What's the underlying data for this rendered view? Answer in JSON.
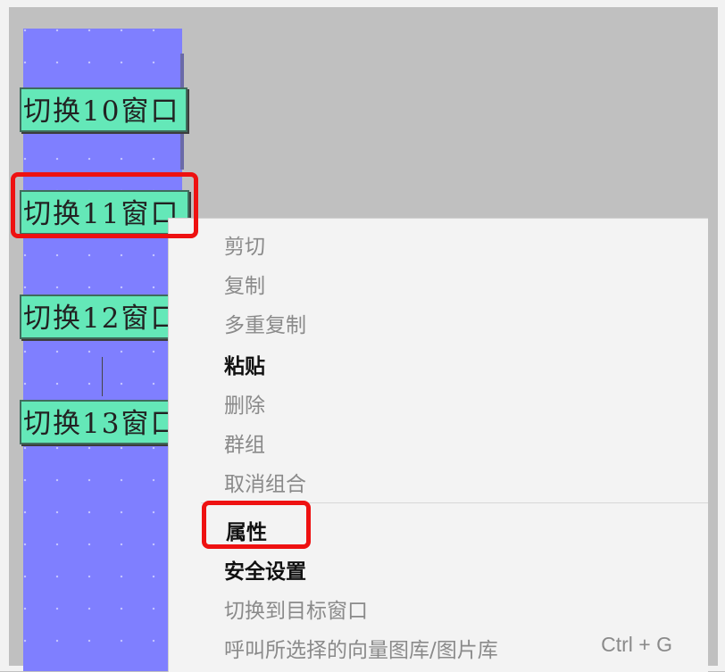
{
  "panel": {
    "buttons": [
      {
        "label": "切换10窗口"
      },
      {
        "label": "切换11窗口"
      },
      {
        "label": "切换12窗口"
      },
      {
        "label": "切换13窗口"
      }
    ]
  },
  "context_menu": {
    "items": [
      {
        "label": "剪切",
        "enabled": false
      },
      {
        "label": "复制",
        "enabled": false
      },
      {
        "label": "多重复制",
        "enabled": false
      },
      {
        "label": "粘贴",
        "enabled": true
      },
      {
        "label": "删除",
        "enabled": false
      },
      {
        "label": "群组",
        "enabled": false
      },
      {
        "label": "取消组合",
        "enabled": false
      },
      {
        "label": "属性",
        "enabled": true
      },
      {
        "label": "安全设置",
        "enabled": true
      },
      {
        "label": "切换到目标窗口",
        "enabled": false
      },
      {
        "label": "呼叫所选择的向量图库/图片库",
        "enabled": false,
        "shortcut": "Ctrl + G"
      }
    ]
  },
  "colors": {
    "panel_bg": "#7f7fff",
    "button_bg": "#64e8b8",
    "highlight": "#ee1111",
    "menu_bg": "#f3f3f3",
    "disabled_text": "#8a8a8a"
  }
}
